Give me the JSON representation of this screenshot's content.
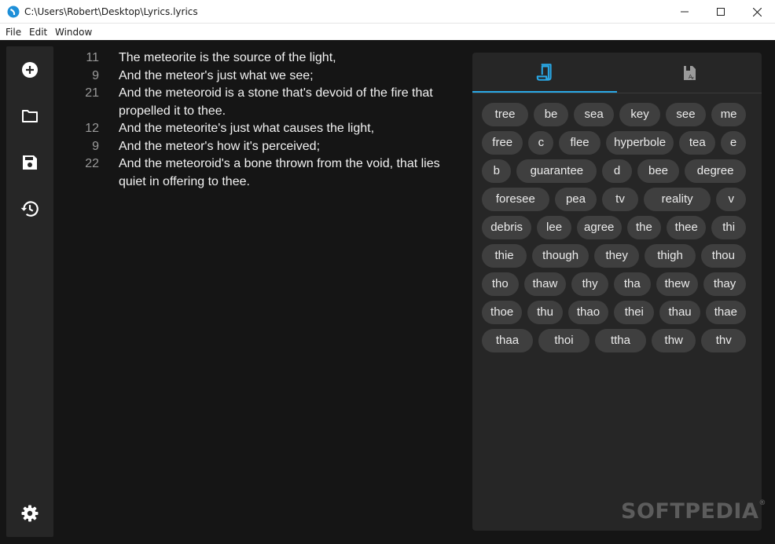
{
  "window": {
    "title": "C:\\Users\\Robert\\Desktop\\Lyrics.lyrics"
  },
  "menu": [
    "File",
    "Edit",
    "Window"
  ],
  "sidebar": {
    "icons": [
      "add-circle-icon",
      "folder-icon",
      "save-icon",
      "history-icon",
      "settings-icon"
    ]
  },
  "lyrics": [
    {
      "syllables": "11",
      "text": "The meteorite is the source of the light,"
    },
    {
      "syllables": "9",
      "text": "And the meteor's just what we see;"
    },
    {
      "syllables": "21",
      "text": "And the meteoroid is a stone that's devoid of the fire that propelled it to thee."
    },
    {
      "syllables": "12",
      "text": "And the meteorite's just what causes the light,"
    },
    {
      "syllables": "9",
      "text": "And the meteor's how it's perceived;"
    },
    {
      "syllables": "22",
      "text": "And the meteoroid's a bone thrown from the void, that lies quiet in offering to thee."
    }
  ],
  "panel": {
    "tabs": [
      {
        "icon": "rhyme-book-icon",
        "active": true
      },
      {
        "icon": "dictionary-icon",
        "active": false
      }
    ],
    "accent": "#29a8e6",
    "rhyme_rows": [
      [
        "tree",
        "be",
        "sea",
        "key",
        "see",
        "me"
      ],
      [
        "free",
        "c",
        "flee",
        "hyperbole",
        "tea",
        "e"
      ],
      [
        "b",
        "guarantee",
        "d",
        "bee",
        "degree"
      ],
      [
        "foresee",
        "pea",
        "tv",
        "reality",
        "v"
      ],
      [
        "debris",
        "lee",
        "agree",
        "the",
        "thee",
        "thi"
      ],
      [
        "thie",
        "though",
        "they",
        "thigh",
        "thou"
      ],
      [
        "tho",
        "thaw",
        "thy",
        "tha",
        "thew",
        "thay"
      ],
      [
        "thoe",
        "thu",
        "thao",
        "thei",
        "thau",
        "thae"
      ],
      [
        "thaa",
        "thoi",
        "ttha",
        "thw",
        "thv"
      ]
    ]
  },
  "watermark": {
    "text": "SOFTPEDIA",
    "mark": "®"
  }
}
